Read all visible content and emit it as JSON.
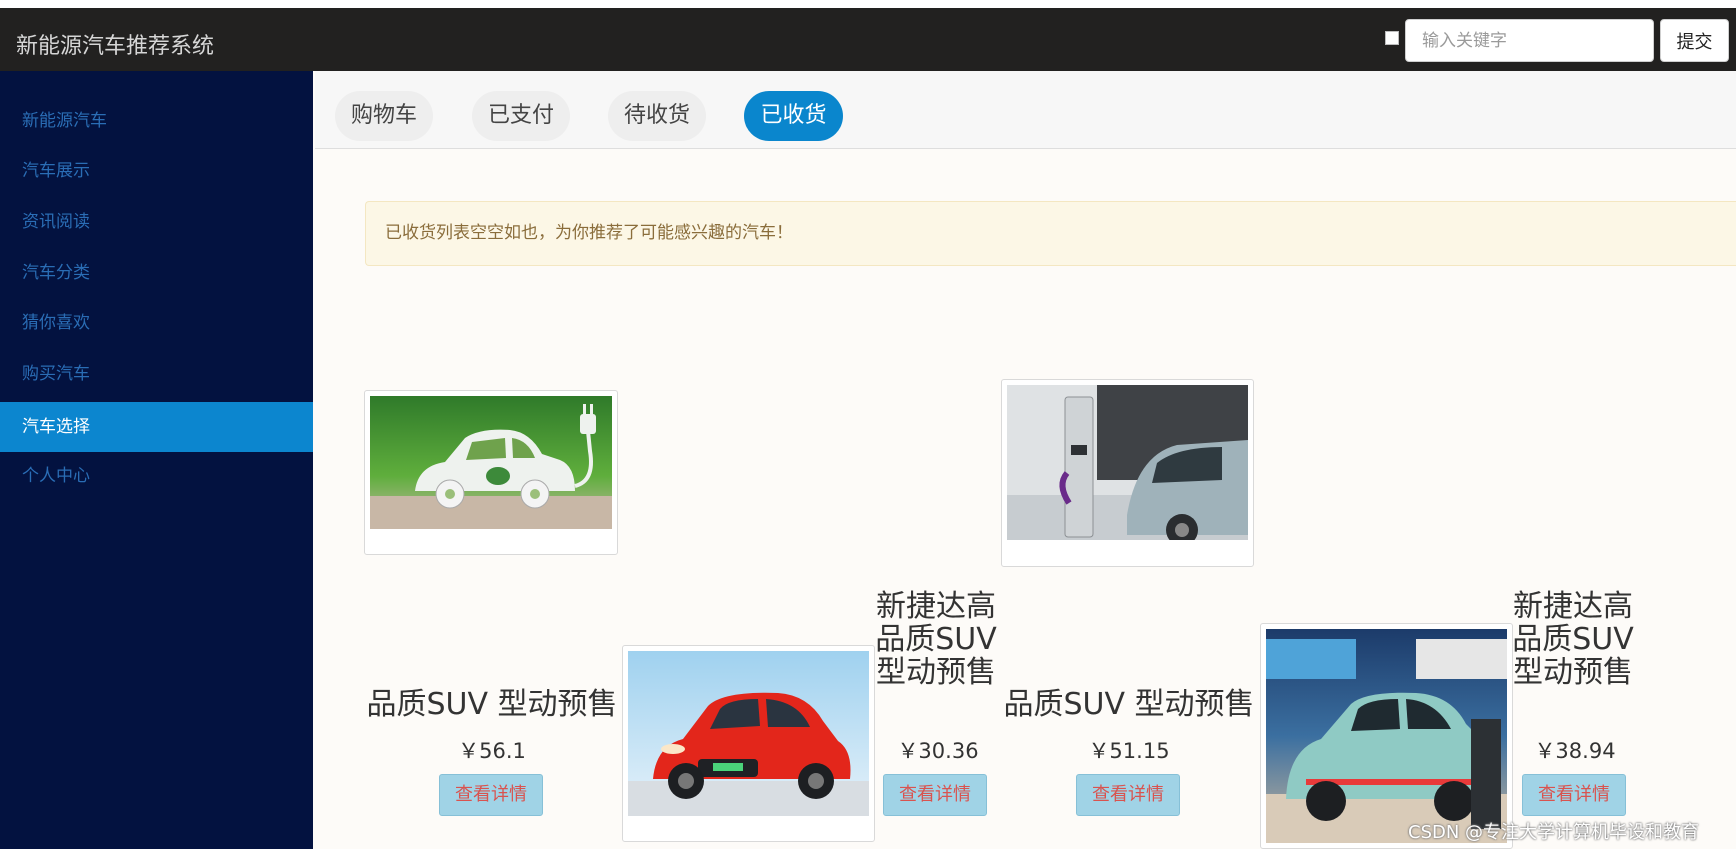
{
  "app": {
    "title": "新能源汽车推荐系统",
    "search_placeholder": "输入关键字",
    "submit_label": "提交"
  },
  "sidebar": {
    "items": [
      {
        "label": "新能源汽车"
      },
      {
        "label": "汽车展示"
      },
      {
        "label": "资讯阅读"
      },
      {
        "label": "汽车分类"
      },
      {
        "label": "猜你喜欢"
      },
      {
        "label": "购买汽车"
      },
      {
        "label": "汽车选择",
        "active": true
      },
      {
        "label": "个人中心"
      }
    ]
  },
  "tabs": [
    {
      "label": "购物车"
    },
    {
      "label": "已支付"
    },
    {
      "label": "待收货"
    },
    {
      "label": "已收货",
      "active": true
    }
  ],
  "alert": {
    "message": "已收货列表空空如也，为你推荐了可能感兴趣的汽车！"
  },
  "cars": [
    {
      "title": "品质SUV 型动预售",
      "price": "￥56.1",
      "detail_label": "查看详情",
      "image": "car-leaf-icon"
    },
    {
      "title": "新捷达高品质SUV 型动预售",
      "price": "￥30.36",
      "detail_label": "查看详情",
      "image": "red-car-photo"
    },
    {
      "title": "品质SUV 型动预售",
      "price": "￥51.15",
      "detail_label": "查看详情",
      "image": "charging-station-photo"
    },
    {
      "title": "新捷达高品质SUV 型动预售",
      "price": "￥38.94",
      "detail_label": "查看详情",
      "image": "showroom-car-photo"
    }
  ],
  "watermark": "CSDN @专注大学计算机毕设和教育",
  "colors": {
    "navbar": "#222120",
    "sidebar": "#031240",
    "sidebar_link": "#2a6db5",
    "accent": "#0c86cf",
    "alert_bg": "#fcf7e6",
    "alert_text": "#8a6d3b",
    "detail_btn": "#a0d3e6",
    "detail_btn_text": "#d9534f"
  }
}
